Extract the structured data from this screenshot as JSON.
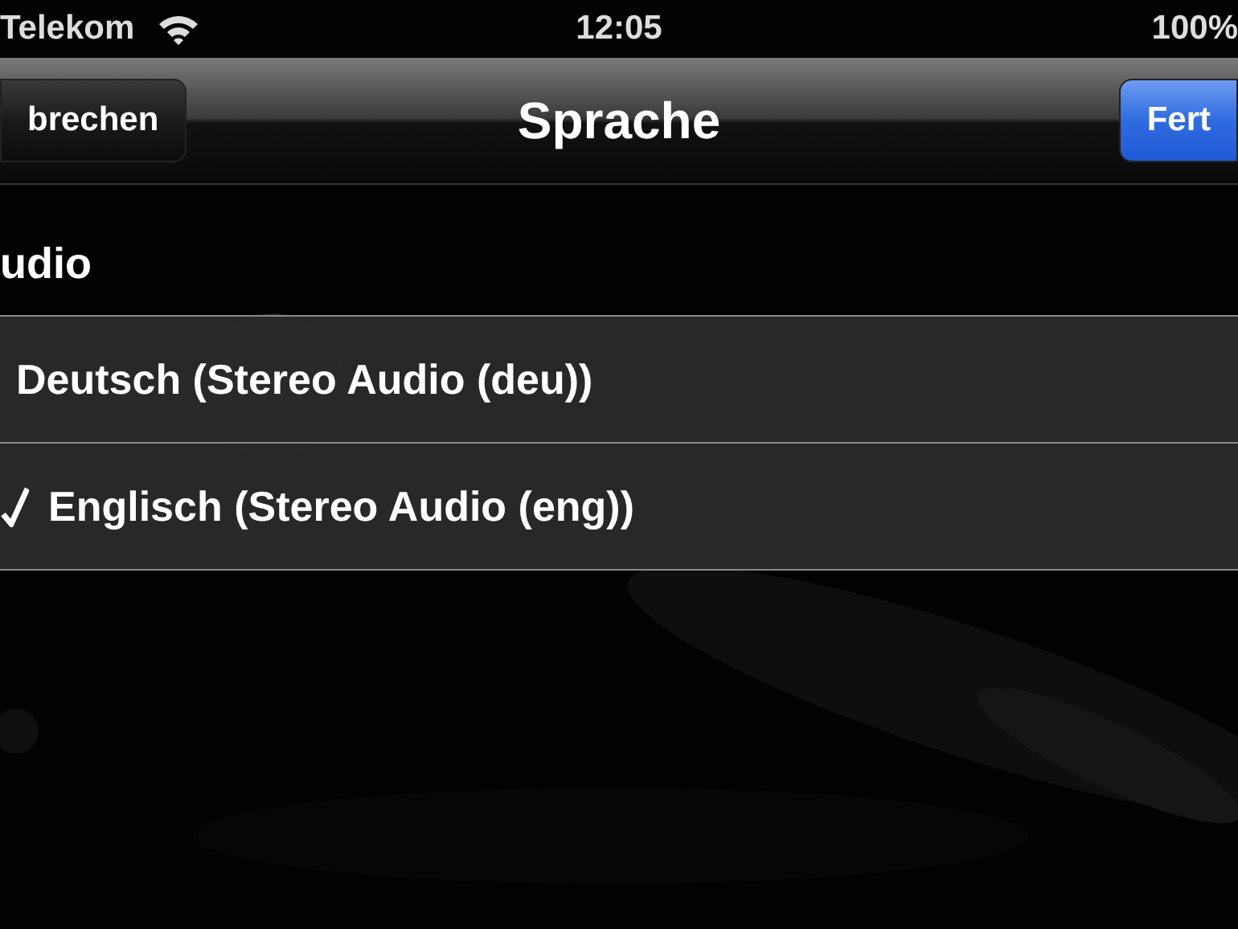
{
  "status_bar": {
    "carrier": "Telekom",
    "time": "12:05",
    "battery": "100%"
  },
  "nav": {
    "left_button": "brechen",
    "title": "Sprache",
    "right_button": "Fert"
  },
  "section": {
    "title": "udio"
  },
  "options": [
    {
      "label": "Deutsch (Stereo Audio (deu))",
      "selected": false
    },
    {
      "label": "Englisch (Stereo Audio (eng))",
      "selected": true
    }
  ]
}
